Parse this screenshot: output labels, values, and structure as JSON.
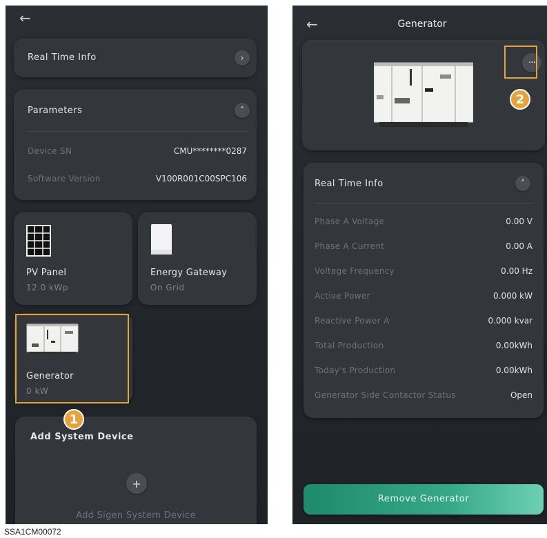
{
  "left": {
    "realtime_label": "Real Time Info",
    "parameters_label": "Parameters",
    "params": [
      {
        "label": "Device SN",
        "value": "CMU********0287"
      },
      {
        "label": "Software Version",
        "value": "V100R001C00SPC106"
      }
    ],
    "tiles": [
      {
        "name": "PV Panel",
        "sub": "12.0 kWp"
      },
      {
        "name": "Energy Gateway",
        "sub": "On Grid"
      },
      {
        "name": "Generator",
        "sub": "0 kW"
      }
    ],
    "add_section_title": "Add System Device",
    "add_device_label": "Add Sigen System Device",
    "badge": "1"
  },
  "right": {
    "page_title": "Generator",
    "more_label": "···",
    "badge": "2",
    "realtime_label": "Real Time Info",
    "rows": [
      {
        "label": "Phase A Voltage",
        "value": "0.00 V"
      },
      {
        "label": "Phase A Current",
        "value": "0.00 A"
      },
      {
        "label": "Voltage Frequency",
        "value": "0.00 Hz"
      },
      {
        "label": "Active Power",
        "value": "0.000 kW"
      },
      {
        "label": "Reactive Power A",
        "value": "0.000 kvar"
      },
      {
        "label": "Total Production",
        "value": "0.00kWh"
      },
      {
        "label": "Today's Production",
        "value": "0.00kWh"
      },
      {
        "label": "Generator Side Contactor Status",
        "value": "Open"
      }
    ],
    "remove_label": "Remove Generator"
  },
  "icons": {
    "back": "←",
    "chevron_right": "›",
    "chevron_up": "˄",
    "plus": "+"
  },
  "colors": {
    "accent_orange": "#e2a33d",
    "remove_button": "#2c9c7b"
  },
  "caption": "SSA1CM00072"
}
